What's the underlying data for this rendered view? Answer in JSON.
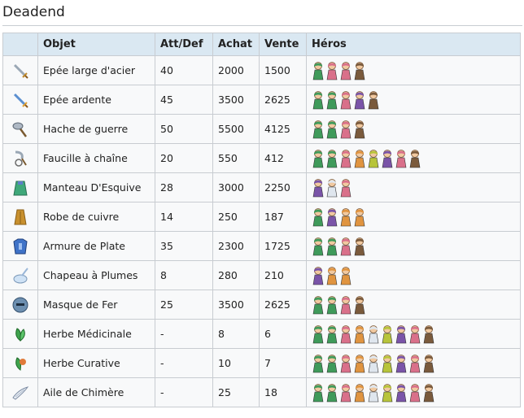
{
  "title": "Deadend",
  "headers": [
    "",
    "Objet",
    "Att/Def",
    "Achat",
    "Vente",
    "Héros"
  ],
  "rows": [
    {
      "icon": "sword-icon",
      "name": "Epée large d'acier",
      "stat": "40",
      "buy": "2000",
      "sell": "1500",
      "heroes": [
        "hero-green-icon",
        "hero-pink-icon",
        "hero-pink-icon",
        "hero-brown-icon"
      ]
    },
    {
      "icon": "flame-sword-icon",
      "name": "Epée ardente",
      "stat": "45",
      "buy": "3500",
      "sell": "2625",
      "heroes": [
        "hero-green-icon",
        "hero-green-icon",
        "hero-pink-icon",
        "hero-purple-icon",
        "hero-brown-icon"
      ]
    },
    {
      "icon": "battle-axe-icon",
      "name": "Hache de guerre",
      "stat": "50",
      "buy": "5500",
      "sell": "4125",
      "heroes": [
        "hero-green-icon",
        "hero-green-icon",
        "hero-pink-icon",
        "hero-brown-icon"
      ]
    },
    {
      "icon": "chain-sickle-icon",
      "name": "Faucille à chaîne",
      "stat": "20",
      "buy": "550",
      "sell": "412",
      "heroes": [
        "hero-green-icon",
        "hero-green-icon",
        "hero-pink-icon",
        "hero-orange-icon",
        "hero-yellow-icon",
        "hero-purple-icon",
        "hero-pink-icon",
        "hero-brown-icon"
      ]
    },
    {
      "icon": "cloak-icon",
      "name": "Manteau D'Esquive",
      "stat": "28",
      "buy": "3000",
      "sell": "2250",
      "heroes": [
        "hero-purple-icon",
        "hero-white-icon",
        "hero-pink-icon"
      ]
    },
    {
      "icon": "robe-icon",
      "name": "Robe de cuivre",
      "stat": "14",
      "buy": "250",
      "sell": "187",
      "heroes": [
        "hero-green-icon",
        "hero-purple-icon",
        "hero-orange-icon",
        "hero-orange-icon"
      ]
    },
    {
      "icon": "plate-armor-icon",
      "name": "Armure de Plate",
      "stat": "35",
      "buy": "2300",
      "sell": "1725",
      "heroes": [
        "hero-green-icon",
        "hero-green-icon",
        "hero-pink-icon",
        "hero-brown-icon"
      ]
    },
    {
      "icon": "feather-hat-icon",
      "name": "Chapeau à Plumes",
      "stat": "8",
      "buy": "280",
      "sell": "210",
      "heroes": [
        "hero-purple-icon",
        "hero-orange-icon",
        "hero-orange-icon"
      ]
    },
    {
      "icon": "iron-mask-icon",
      "name": "Masque de Fer",
      "stat": "25",
      "buy": "3500",
      "sell": "2625",
      "heroes": [
        "hero-green-icon",
        "hero-green-icon",
        "hero-pink-icon",
        "hero-brown-icon"
      ]
    },
    {
      "icon": "medicinal-herb-icon",
      "name": "Herbe Médicinale",
      "stat": "-",
      "buy": "8",
      "sell": "6",
      "heroes": [
        "hero-green-icon",
        "hero-green-icon",
        "hero-pink-icon",
        "hero-orange-icon",
        "hero-white-icon",
        "hero-yellow-icon",
        "hero-purple-icon",
        "hero-pink-icon",
        "hero-brown-icon"
      ]
    },
    {
      "icon": "curative-herb-icon",
      "name": "Herbe Curative",
      "stat": "-",
      "buy": "10",
      "sell": "7",
      "heroes": [
        "hero-green-icon",
        "hero-green-icon",
        "hero-pink-icon",
        "hero-orange-icon",
        "hero-white-icon",
        "hero-yellow-icon",
        "hero-purple-icon",
        "hero-pink-icon",
        "hero-brown-icon"
      ]
    },
    {
      "icon": "chimera-wing-icon",
      "name": "Aile de Chimère",
      "stat": "-",
      "buy": "25",
      "sell": "18",
      "heroes": [
        "hero-green-icon",
        "hero-green-icon",
        "hero-pink-icon",
        "hero-orange-icon",
        "hero-white-icon",
        "hero-yellow-icon",
        "hero-purple-icon",
        "hero-pink-icon",
        "hero-brown-icon"
      ]
    }
  ],
  "colors": {
    "header_bg": "#dae8f2",
    "row_bg": "#f8f9fa",
    "border": "#c8ccd1",
    "hero_green": "#3f9a5a",
    "hero_pink": "#d9708a",
    "hero_brown": "#7a5a3c",
    "hero_purple": "#7a54a8",
    "hero_orange": "#e09440",
    "hero_yellow": "#b7c43a",
    "hero_white": "#dfe6ee"
  }
}
